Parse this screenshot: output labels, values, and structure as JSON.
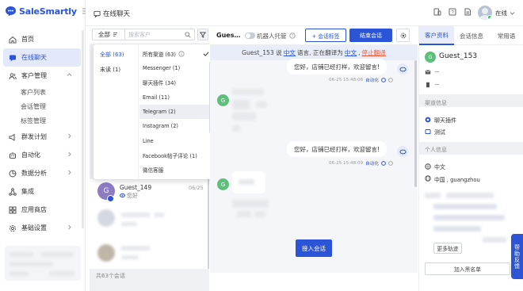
{
  "brand": {
    "name": "SaleSmartly",
    "color": "#2b54d6"
  },
  "sidebar": {
    "items": [
      {
        "label": "首页",
        "icon": "home-icon"
      },
      {
        "label": "在线聊天",
        "icon": "chat-icon",
        "active": true
      },
      {
        "label": "客户管理",
        "icon": "users-icon",
        "expanded": true
      },
      {
        "label": "群发计划",
        "icon": "broadcast-icon"
      },
      {
        "label": "自动化",
        "icon": "robot-icon"
      },
      {
        "label": "数据分析",
        "icon": "analytics-icon"
      },
      {
        "label": "集成",
        "icon": "integration-icon"
      },
      {
        "label": "应用商店",
        "icon": "app-store-icon"
      },
      {
        "label": "基础设置",
        "icon": "settings-icon"
      }
    ],
    "subitems": [
      "客户列表",
      "会话管理",
      "标签管理"
    ]
  },
  "topbar": {
    "title": "在线聊天",
    "status": "在线"
  },
  "list": {
    "filter_label": "全部",
    "search_placeholder": "搜索客户",
    "footer": "共63个会话",
    "chat_item": {
      "name": "Guest_149",
      "date": "06/25",
      "preview": "您好"
    }
  },
  "dropdown": {
    "left": [
      {
        "label": "全部 (63)"
      },
      {
        "label": "未读 (1)"
      }
    ],
    "right": [
      {
        "label": "所有渠道 (63)",
        "checked": true
      },
      {
        "label": "Messenger (1)"
      },
      {
        "label": "聊天插件 (34)"
      },
      {
        "label": "Email (11)"
      },
      {
        "label": "Telegram (2)",
        "highlighted": true
      },
      {
        "label": "Instagram (2)"
      },
      {
        "label": "Line"
      },
      {
        "label": "Facebook帖子评论 (1)"
      },
      {
        "label": "微信客服"
      }
    ]
  },
  "chat": {
    "guest": "Guest_153",
    "robot_label": "机器人托管",
    "add_tag_button": "+ 会话标签",
    "end_button": "结束会话",
    "translate": {
      "p1": "Guest_153 说",
      "lang1": "中文",
      "p2": "语言, 正在翻译为",
      "lang2": "中文",
      "comma": ",",
      "stop": "停止翻译"
    },
    "messages": [
      {
        "text": "您好，店铺已经打样，欢迎留言!",
        "time": "06-25 15:48:06",
        "tag": "自动化"
      },
      {
        "text": "您好，店铺已经打样，欢迎留言!",
        "time": "06-25 15:48:09",
        "tag": "自动化"
      }
    ],
    "guest_initial": "G",
    "accept_button": "接入会话"
  },
  "right_panel": {
    "tabs": [
      "客户资料",
      "会话信息",
      "常用语"
    ],
    "customer_name": "Guest_153",
    "customer_initial": "G",
    "email_value": "--",
    "phone_value": "--",
    "channel_section": "渠道信息",
    "channel_name": "聊天插件",
    "channel_sub": "测试",
    "personal_section": "个人信息",
    "language": "中文",
    "location": "中国 , guangzhou",
    "more_button": "更多轨迹",
    "blacklist_button": "加入黑名单"
  },
  "feedback": "帮助反馈"
}
